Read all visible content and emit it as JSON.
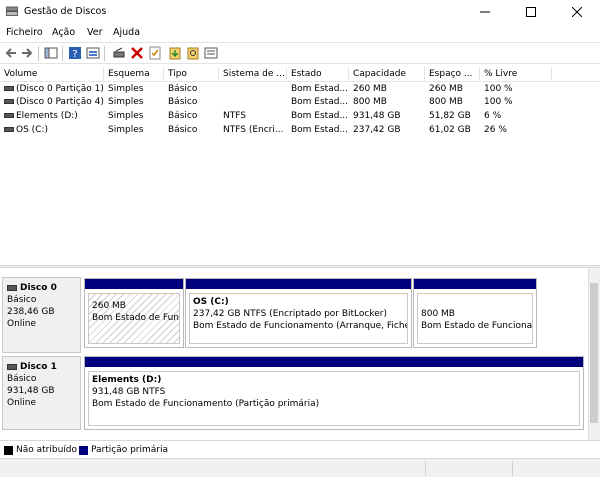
{
  "window": {
    "title": "Gestão de Discos"
  },
  "menu": [
    "Ficheiro",
    "Ação",
    "Ver",
    "Ajuda"
  ],
  "table": {
    "columns": [
      "Volume",
      "Esquema",
      "Tipo",
      "Sistema de ...",
      "Estado",
      "Capacidade",
      "Espaço ...",
      "% Livre"
    ],
    "rows": [
      [
        "(Disco 0 Partição 1)",
        "Simples",
        "Básico",
        "",
        "Bom Estad...",
        "260 MB",
        "260 MB",
        "100 %"
      ],
      [
        "(Disco 0 Partição 4)",
        "Simples",
        "Básico",
        "",
        "Bom Estad...",
        "800 MB",
        "800 MB",
        "100 %"
      ],
      [
        "Elements (D:)",
        "Simples",
        "Básico",
        "NTFS",
        "Bom Estad...",
        "931,48 GB",
        "51,82 GB",
        "6 %"
      ],
      [
        "OS (C:)",
        "Simples",
        "Básico",
        "NTFS (Encri...",
        "Bom Estad...",
        "237,42 GB",
        "61,02 GB",
        "26 %"
      ]
    ]
  },
  "disks": [
    {
      "name": "Disco 0",
      "type": "Básico",
      "size": "238,46 GB",
      "status": "Online",
      "partitions": [
        {
          "title": "",
          "size": "260 MB",
          "status": "Bom Estado de Funci"
        },
        {
          "title": "OS  (C:)",
          "size": "237,42 GB NTFS (Encriptado por BitLocker)",
          "status": "Bom Estado de Funcionamento (Arranque, Ficheiro"
        },
        {
          "title": "",
          "size": "800 MB",
          "status": "Bom Estado de Funcionan"
        }
      ]
    },
    {
      "name": "Disco 1",
      "type": "Básico",
      "size": "931,48 GB",
      "status": "Online",
      "partitions": [
        {
          "title": "Elements  (D:)",
          "size": "931,48 GB NTFS",
          "status": "Bom Estado de Funcionamento (Partição primária)"
        }
      ]
    }
  ],
  "legend": [
    {
      "label": "Não atribuído",
      "color": "#000000"
    },
    {
      "label": "Partição primária",
      "color": "#00007e"
    }
  ],
  "colors": {
    "primary_partition": "#00007e",
    "unallocated": "#000000"
  }
}
